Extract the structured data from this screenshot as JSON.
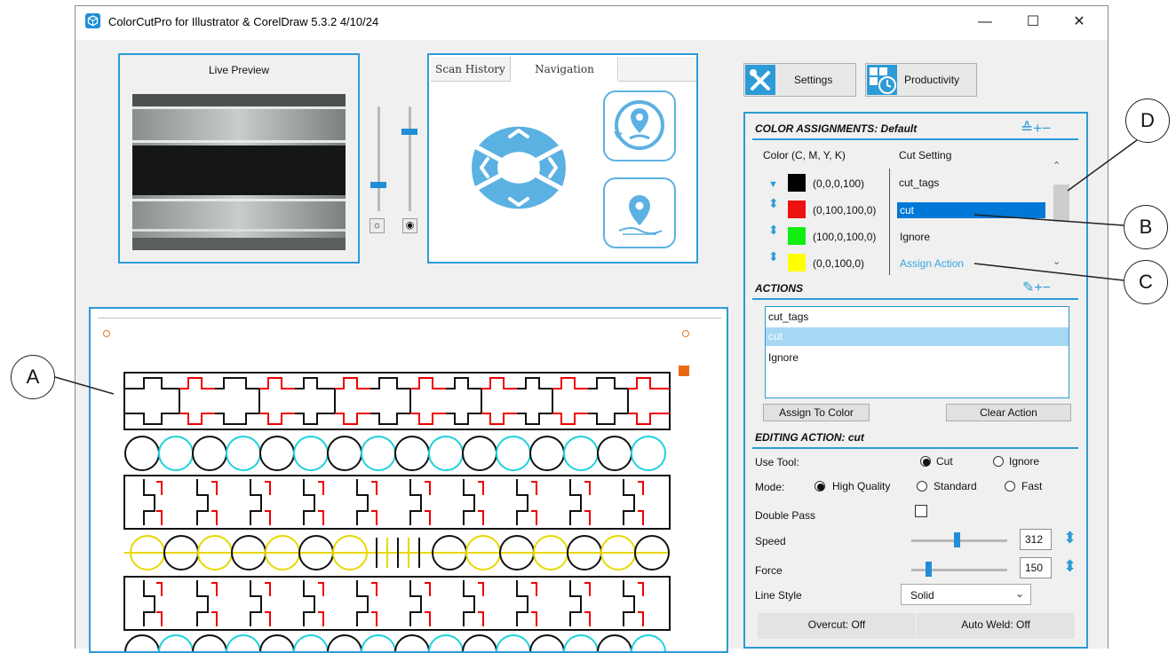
{
  "window": {
    "title": "ColorCutPro for Illustrator & CorelDraw 5.3.2 4/10/24",
    "minimize": "—",
    "maximize": "☐",
    "close": "✕"
  },
  "live_preview": {
    "title": "Live Preview"
  },
  "nav": {
    "tabs": [
      "Scan History",
      "Navigation"
    ],
    "active_tab": "Navigation"
  },
  "toolbar": {
    "settings_label": "Settings",
    "productivity_label": "Productivity"
  },
  "color_assignments": {
    "header": "COLOR ASSIGNMENTS: Default",
    "header_icons": "≙+−",
    "col_color": "Color (C, M, Y, K)",
    "col_cut": "Cut Setting",
    "rows": [
      {
        "swatch": "#000000",
        "value": "(0,0,0,100)",
        "cut": "cut_tags",
        "selected": false
      },
      {
        "swatch": "#ee1111",
        "value": "(0,100,100,0)",
        "cut": "cut",
        "selected": true
      },
      {
        "swatch": "#11ee11",
        "value": "(100,0,100,0)",
        "cut": "Ignore",
        "selected": false
      },
      {
        "swatch": "#ffff00",
        "value": "(0,0,100,0)",
        "cut": "Assign Action",
        "selected": false
      }
    ]
  },
  "actions": {
    "header": "ACTIONS",
    "header_icons": "✎+−",
    "items": [
      "cut_tags",
      "cut",
      "Ignore"
    ],
    "assign_btn": "Assign To Color",
    "clear_btn": "Clear Action"
  },
  "editing": {
    "header": "EDITING ACTION: cut",
    "use_tool_label": "Use Tool:",
    "tool_options": [
      "Cut",
      "Ignore"
    ],
    "tool_selected": "Cut",
    "mode_label": "Mode:",
    "mode_options": [
      "High Quality",
      "Standard",
      "Fast"
    ],
    "mode_selected": "High Quality",
    "double_pass_label": "Double Pass",
    "speed_label": "Speed",
    "speed_value": "312",
    "force_label": "Force",
    "force_value": "150",
    "line_style_label": "Line Style",
    "line_style_value": "Solid",
    "overcut_btn": "Overcut: Off",
    "autoweld_btn": "Auto Weld: Off"
  },
  "callouts": {
    "a": "A",
    "b": "B",
    "c": "C",
    "d": "D"
  },
  "colors": {
    "accent": "#2d9bd6",
    "selection": "#0078d7",
    "link": "#3ba3e0"
  }
}
